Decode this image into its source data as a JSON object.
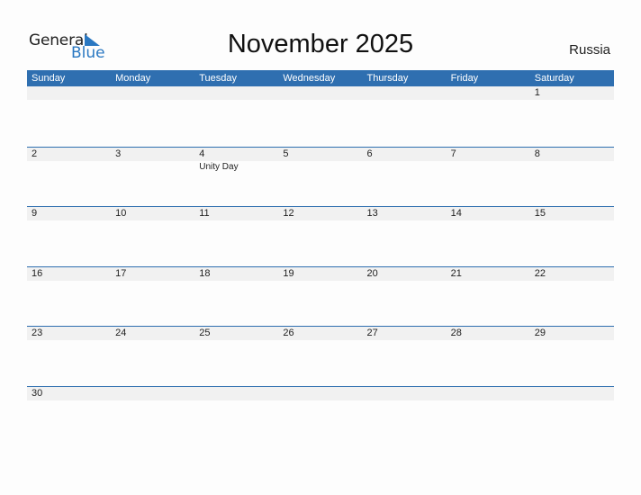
{
  "logo": {
    "word1": "General",
    "word2": "Blue",
    "accent": "#2a78c2"
  },
  "header": {
    "title": "November 2025",
    "country": "Russia"
  },
  "calendar": {
    "weekdays": [
      "Sunday",
      "Monday",
      "Tuesday",
      "Wednesday",
      "Thursday",
      "Friday",
      "Saturday"
    ],
    "header_color": "#2f6fb0",
    "weeks": [
      [
        {
          "day": ""
        },
        {
          "day": ""
        },
        {
          "day": ""
        },
        {
          "day": ""
        },
        {
          "day": ""
        },
        {
          "day": ""
        },
        {
          "day": "1"
        }
      ],
      [
        {
          "day": "2"
        },
        {
          "day": "3"
        },
        {
          "day": "4",
          "event": "Unity Day"
        },
        {
          "day": "5"
        },
        {
          "day": "6"
        },
        {
          "day": "7"
        },
        {
          "day": "8"
        }
      ],
      [
        {
          "day": "9"
        },
        {
          "day": "10"
        },
        {
          "day": "11"
        },
        {
          "day": "12"
        },
        {
          "day": "13"
        },
        {
          "day": "14"
        },
        {
          "day": "15"
        }
      ],
      [
        {
          "day": "16"
        },
        {
          "day": "17"
        },
        {
          "day": "18"
        },
        {
          "day": "19"
        },
        {
          "day": "20"
        },
        {
          "day": "21"
        },
        {
          "day": "22"
        }
      ],
      [
        {
          "day": "23"
        },
        {
          "day": "24"
        },
        {
          "day": "25"
        },
        {
          "day": "26"
        },
        {
          "day": "27"
        },
        {
          "day": "28"
        },
        {
          "day": "29"
        }
      ],
      [
        {
          "day": "30"
        },
        {
          "day": ""
        },
        {
          "day": ""
        },
        {
          "day": ""
        },
        {
          "day": ""
        },
        {
          "day": ""
        },
        {
          "day": ""
        }
      ]
    ]
  }
}
